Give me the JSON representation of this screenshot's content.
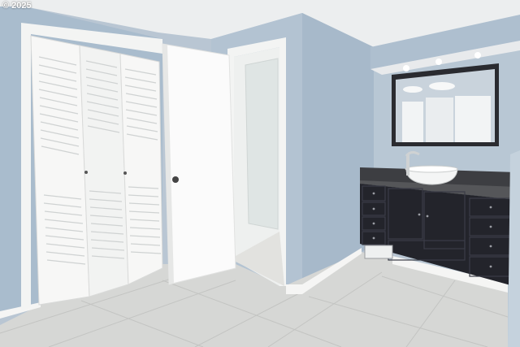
{
  "watermark": {
    "text": "© 2025"
  },
  "colors": {
    "wall": "#aebfcf",
    "wall_shadow": "#9fb1c2",
    "ceiling": "#e9ecee",
    "floor": "#d5d6d4",
    "trim": "#f4f5f4",
    "vanity": "#22232b",
    "counter": "#4a4a4c"
  },
  "scene": {
    "objects": [
      "bifold-closet-door",
      "open-door",
      "doorway-to-shower",
      "vanity-cabinet",
      "vessel-sink",
      "wall-mirror",
      "vanity-light",
      "tile-floor"
    ]
  }
}
